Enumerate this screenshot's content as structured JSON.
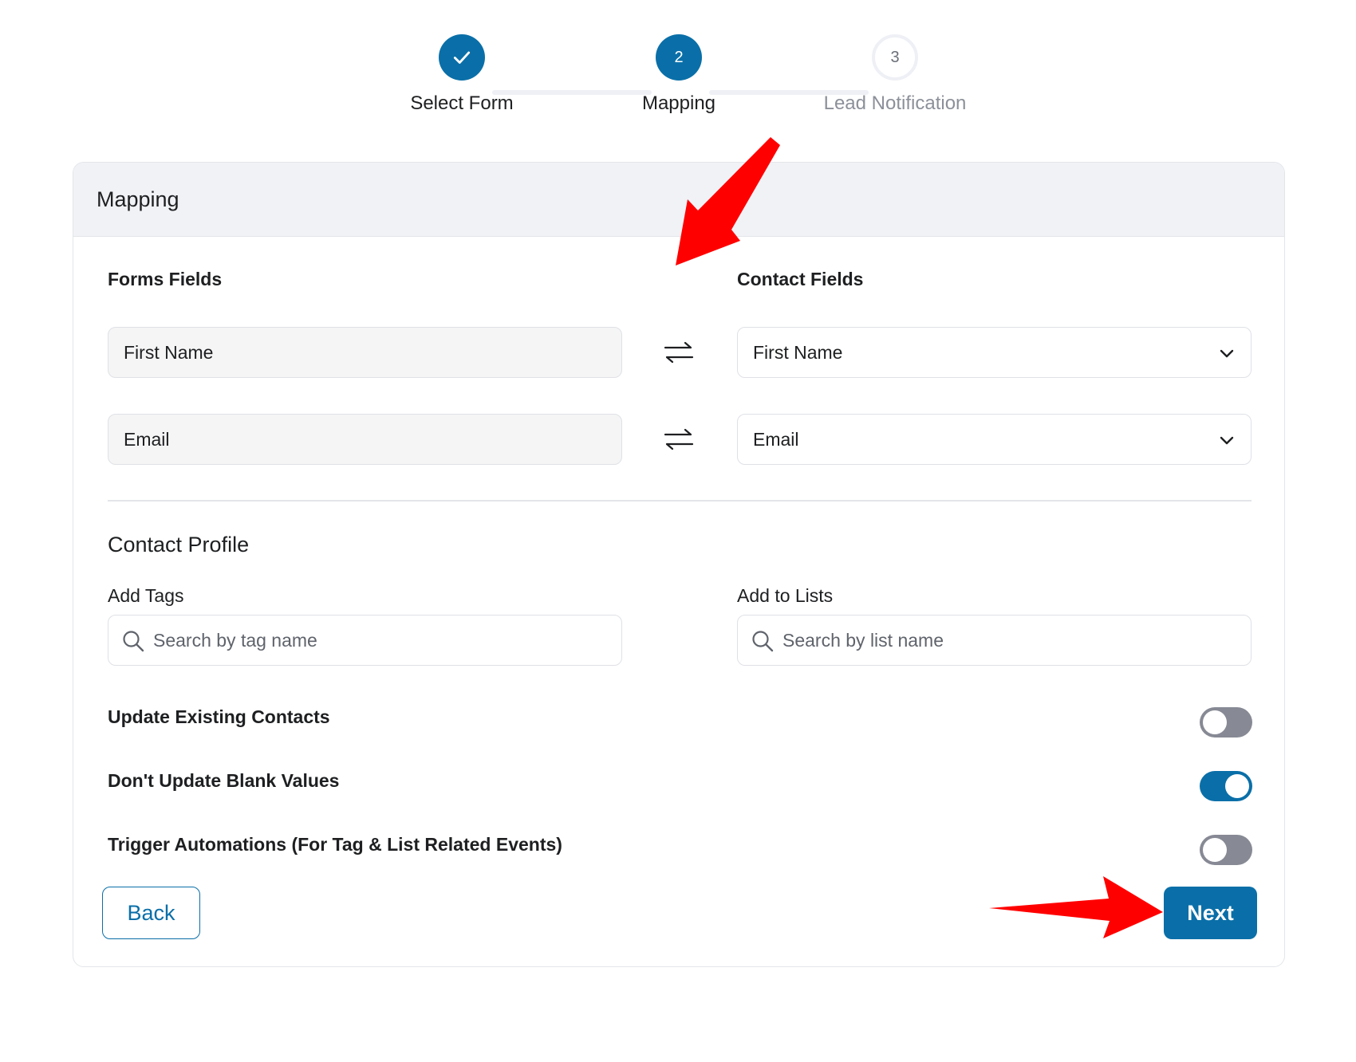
{
  "stepper": {
    "steps": [
      {
        "number": "1",
        "label": "Select Form",
        "state": "done",
        "icon": "check-icon"
      },
      {
        "number": "2",
        "label": "Mapping",
        "state": "active"
      },
      {
        "number": "3",
        "label": "Lead Notification",
        "state": "pending"
      }
    ]
  },
  "card": {
    "title": "Mapping",
    "forms_fields_heading": "Forms Fields",
    "contact_fields_heading": "Contact Fields",
    "rows": [
      {
        "form_field": "First Name",
        "contact_field": "First Name"
      },
      {
        "form_field": "Email",
        "contact_field": "Email"
      }
    ],
    "swap_icon": "swap-arrows-icon",
    "dropdown_icon": "chevron-down-icon"
  },
  "profile": {
    "title": "Contact Profile",
    "tags_label": "Add Tags",
    "tags_placeholder": "Search by tag name",
    "lists_label": "Add to Lists",
    "lists_placeholder": "Search by list name",
    "search_icon": "search-icon"
  },
  "toggles": [
    {
      "label": "Update Existing Contacts",
      "on": false
    },
    {
      "label": "Don't Update Blank Values",
      "on": true
    },
    {
      "label": "Trigger Automations (For Tag & List Related Events)",
      "on": false
    }
  ],
  "buttons": {
    "back": "Back",
    "next": "Next"
  },
  "colors": {
    "primary": "#0a6fa8",
    "toggle_off": "#878a94",
    "header_bg": "#f1f2f6",
    "annotation_arrow": "#ff0000"
  }
}
